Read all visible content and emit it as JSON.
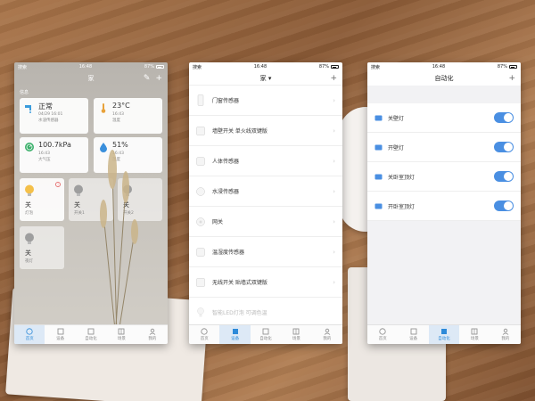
{
  "colors": {
    "accent": "#2d8ad9",
    "toggle_on": "#4a8fe2"
  },
  "phones": [
    {
      "status": {
        "carrier": "搜索",
        "time": "16:48",
        "battery": "87%"
      },
      "title": "家",
      "section_label": "信息",
      "sensors": [
        {
          "value": "正常",
          "line1": "04/29 16:01",
          "line2": "水浸传感器",
          "icon": "water-tap-icon"
        },
        {
          "value": "23°C",
          "line1": "16:43",
          "line2": "温度",
          "icon": "thermometer-icon"
        },
        {
          "value": "100.7kPa",
          "line1": "16:43",
          "line2": "大气压",
          "icon": "pressure-gauge-icon"
        },
        {
          "value": "51%",
          "line1": "16:43",
          "line2": "湿度",
          "icon": "humidity-drop-icon"
        }
      ],
      "devices": [
        {
          "state": "关",
          "name": "灯泡",
          "badge": "!"
        },
        {
          "state": "关",
          "name": "开关1"
        },
        {
          "state": "关",
          "name": "开关2"
        },
        {
          "state": "关",
          "name": "夜灯"
        }
      ]
    },
    {
      "status": {
        "carrier": "搜索",
        "time": "16:48",
        "battery": "87%"
      },
      "title": "家 ▾",
      "devices": [
        {
          "name": "门窗传感器"
        },
        {
          "name": "墙壁开关 单火线双键版"
        },
        {
          "name": "人体传感器"
        },
        {
          "name": "水浸传感器"
        },
        {
          "name": "网关"
        },
        {
          "name": "温湿度传感器"
        },
        {
          "name": "无线开关 贴墙式双键版"
        },
        {
          "name": "智能LED灯泡 可调色温"
        }
      ]
    },
    {
      "status": {
        "carrier": "搜索",
        "time": "16:48",
        "battery": "87%"
      },
      "title": "自动化",
      "automations": [
        {
          "name": "关壁灯",
          "enabled": true
        },
        {
          "name": "开壁灯",
          "enabled": true
        },
        {
          "name": "关卧室顶灯",
          "enabled": true
        },
        {
          "name": "开卧室顶灯",
          "enabled": true
        }
      ]
    }
  ],
  "tabbar": [
    "首页",
    "设备",
    "自动化",
    "场景",
    "我的"
  ]
}
